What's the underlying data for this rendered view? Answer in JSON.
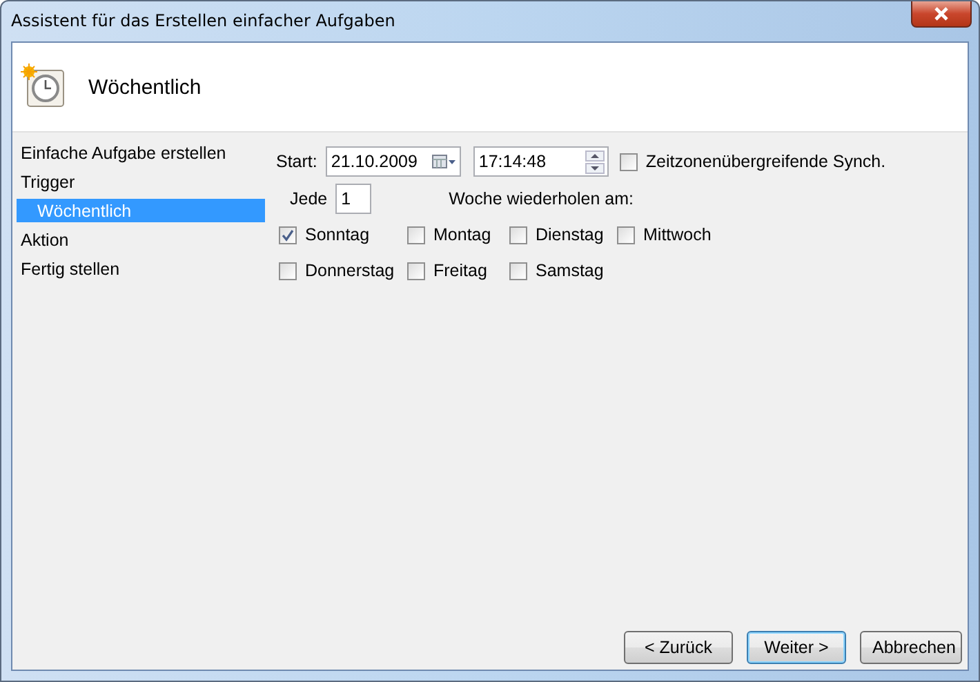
{
  "window": {
    "title": "Assistent für das Erstellen einfacher Aufgaben"
  },
  "header": {
    "title": "Wöchentlich"
  },
  "sidebar": {
    "items": [
      {
        "label": "Einfache Aufgabe erstellen",
        "selected": false
      },
      {
        "label": "Trigger",
        "selected": false,
        "children": [
          {
            "label": "Wöchentlich",
            "selected": true
          }
        ]
      },
      {
        "label": "Aktion",
        "selected": false
      },
      {
        "label": "Fertig stellen",
        "selected": false
      }
    ]
  },
  "start": {
    "label": "Start:",
    "date": "21.10.2009",
    "time": "17:14:48",
    "sync": {
      "label": "Zeitzonenübergreifende Synch.",
      "checked": false
    }
  },
  "recur": {
    "label": "Jede",
    "value": "1",
    "suffix": "Woche wiederholen am:"
  },
  "days": [
    {
      "label": "Sonntag",
      "checked": true
    },
    {
      "label": "Montag",
      "checked": false
    },
    {
      "label": "Dienstag",
      "checked": false
    },
    {
      "label": "Mittwoch",
      "checked": false
    },
    {
      "label": "Donnerstag",
      "checked": false
    },
    {
      "label": "Freitag",
      "checked": false
    },
    {
      "label": "Samstag",
      "checked": false
    }
  ],
  "buttons": [
    {
      "label": "< Zurück",
      "default": false
    },
    {
      "label": "Weiter >",
      "default": true
    },
    {
      "label": "Abbrechen",
      "default": false
    }
  ]
}
